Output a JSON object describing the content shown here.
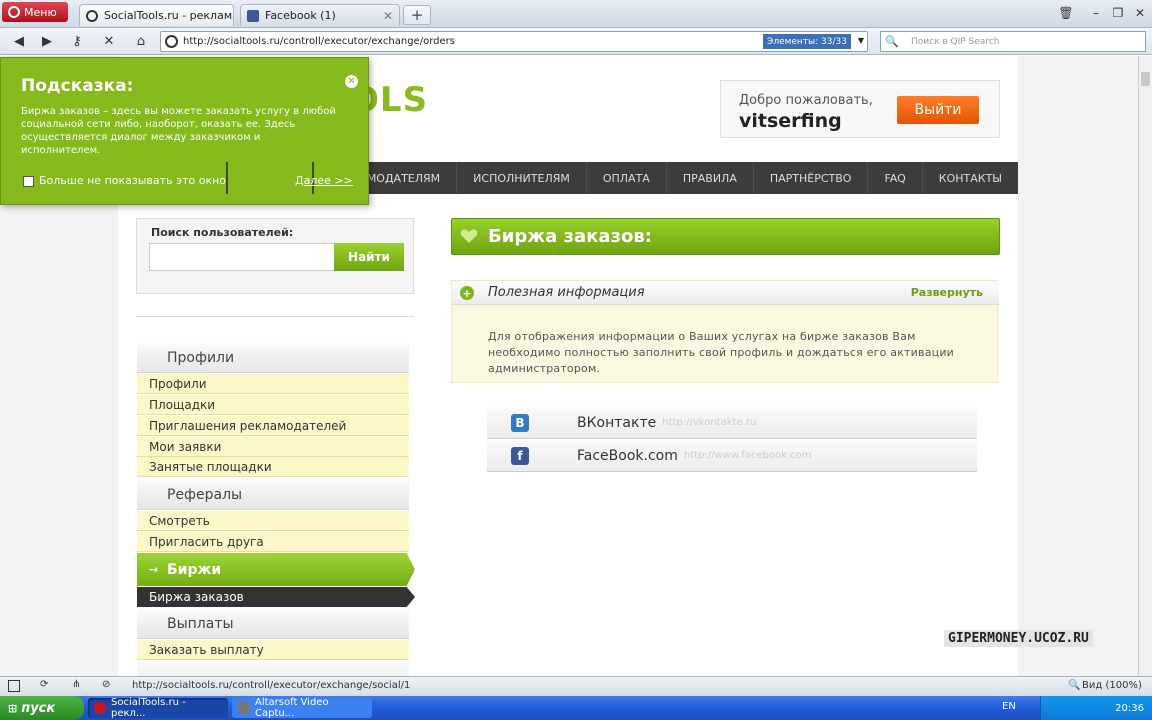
{
  "browser": {
    "menu_label": "Меню",
    "tabs": [
      {
        "label": "SocialTools.ru - реклама..."
      },
      {
        "label": "Facebook (1)"
      }
    ],
    "address": "http://socialtools.ru/controll/executor/exchange/orders",
    "elements_badge": "Элементы:   33/33",
    "search_placeholder": "Поиск в QIP Search"
  },
  "header": {
    "logo_fragment": "OLS",
    "welcome_label": "Добро пожаловать,",
    "username": "vitserfing",
    "logout_label": "Выйти"
  },
  "nav": {
    "items": [
      "РЕКЛАМОДАТЕЛЯМ",
      "ИСПОЛНИТЕЛЯМ",
      "ОПЛАТА",
      "ПРАВИЛА",
      "ПАРТНЁРСТВО",
      "FAQ",
      "КОНТАКТЫ"
    ]
  },
  "tooltip": {
    "title": "Подсказка:",
    "text": "Биржа заказов – здесь вы можете заказать услугу в любой социальной сети либо, наоборот, оказать ее. Здесь осуществляется диалог между заказчиком и исполнителем.",
    "checkbox_label": "Больше не показывать это окно",
    "next_label": "Далее >>"
  },
  "sidebar": {
    "search_label": "Поиск пользователей:",
    "search_button": "Найти",
    "sections": [
      {
        "title": "Профили",
        "items": [
          "Профили",
          "Площадки",
          "Приглашения рекламодателей",
          "Мои заявки",
          "Занятые площадки"
        ]
      },
      {
        "title": "Рефералы",
        "items": [
          "Смотреть",
          "Пригласить друга"
        ]
      },
      {
        "title": "Биржи",
        "items": [
          "Биржа заказов"
        ]
      },
      {
        "title": "Выплаты",
        "items": [
          "Заказать выплату"
        ]
      }
    ]
  },
  "main": {
    "title": "Биржа заказов:",
    "info_title": "Полезная информация",
    "info_expand": "Развернуть",
    "info_text": "Для отображения информации о Ваших услугах на бирже заказов Вам необходимо полностью заполнить свой профиль и дождаться его активации администратором.",
    "socials": [
      {
        "name": "ВКонтакте",
        "url": "http://vkontakte.ru",
        "icon": "vk-icon",
        "color": "#2f7ec4"
      },
      {
        "name": "FaceBook.com",
        "url": "http://www.facebook.com",
        "icon": "facebook-icon",
        "color": "#3b5998"
      }
    ]
  },
  "watermark": "GIPERMONEY.UCOZ.RU",
  "status": {
    "url": "http://socialtools.ru/controll/executor/exchange/social/1",
    "zoom": "Вид (100%)"
  },
  "taskbar": {
    "start_label": "пуск",
    "tasks": [
      "SocialTools.ru - рекл...",
      "Altarsoft Video Captu..."
    ],
    "lang": "EN",
    "clock": "20:36"
  },
  "colors": {
    "accent": "#86b91b",
    "orange": "#ee6a0e",
    "nav_bg": "#3c3c3c"
  }
}
